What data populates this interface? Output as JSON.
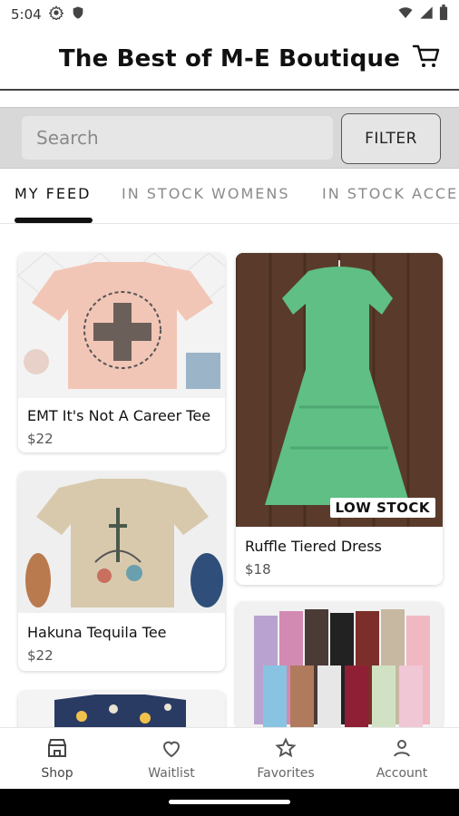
{
  "status_bar": {
    "time": "5:04",
    "icons": [
      "gear-icon",
      "shield-icon",
      "wifi-icon",
      "signal-icon",
      "battery-icon"
    ]
  },
  "header": {
    "title": "The Best of M-E Boutique",
    "cart_icon": "cart-icon"
  },
  "search": {
    "placeholder": "Search",
    "filter_label": "FILTER"
  },
  "tabs": [
    {
      "label": "MY FEED",
      "active": true
    },
    {
      "label": "IN STOCK WOMENS",
      "active": false
    },
    {
      "label": "IN STOCK ACCE",
      "active": false
    }
  ],
  "products": [
    {
      "title": "EMT It's Not A Career Tee",
      "price": "$22",
      "image_colors": {
        "bg": "#f3f3f3",
        "shirt": "#f2c6b6"
      }
    },
    {
      "title": "Hakuna Tequila Tee",
      "price": "$22",
      "image_colors": {
        "bg": "#efefef",
        "shirt": "#d8c9ad"
      }
    },
    {
      "title": "Ruffle Tiered Dress",
      "price": "$18",
      "badge": "LOW STOCK",
      "image_colors": {
        "bg": "#5a3b2b",
        "dress": "#5fbf84"
      }
    }
  ],
  "bottom_nav": [
    {
      "label": "Shop",
      "icon": "store-icon",
      "active": true
    },
    {
      "label": "Waitlist",
      "icon": "heart-icon",
      "active": false
    },
    {
      "label": "Favorites",
      "icon": "star-icon",
      "active": false
    },
    {
      "label": "Account",
      "icon": "person-icon",
      "active": false
    }
  ]
}
